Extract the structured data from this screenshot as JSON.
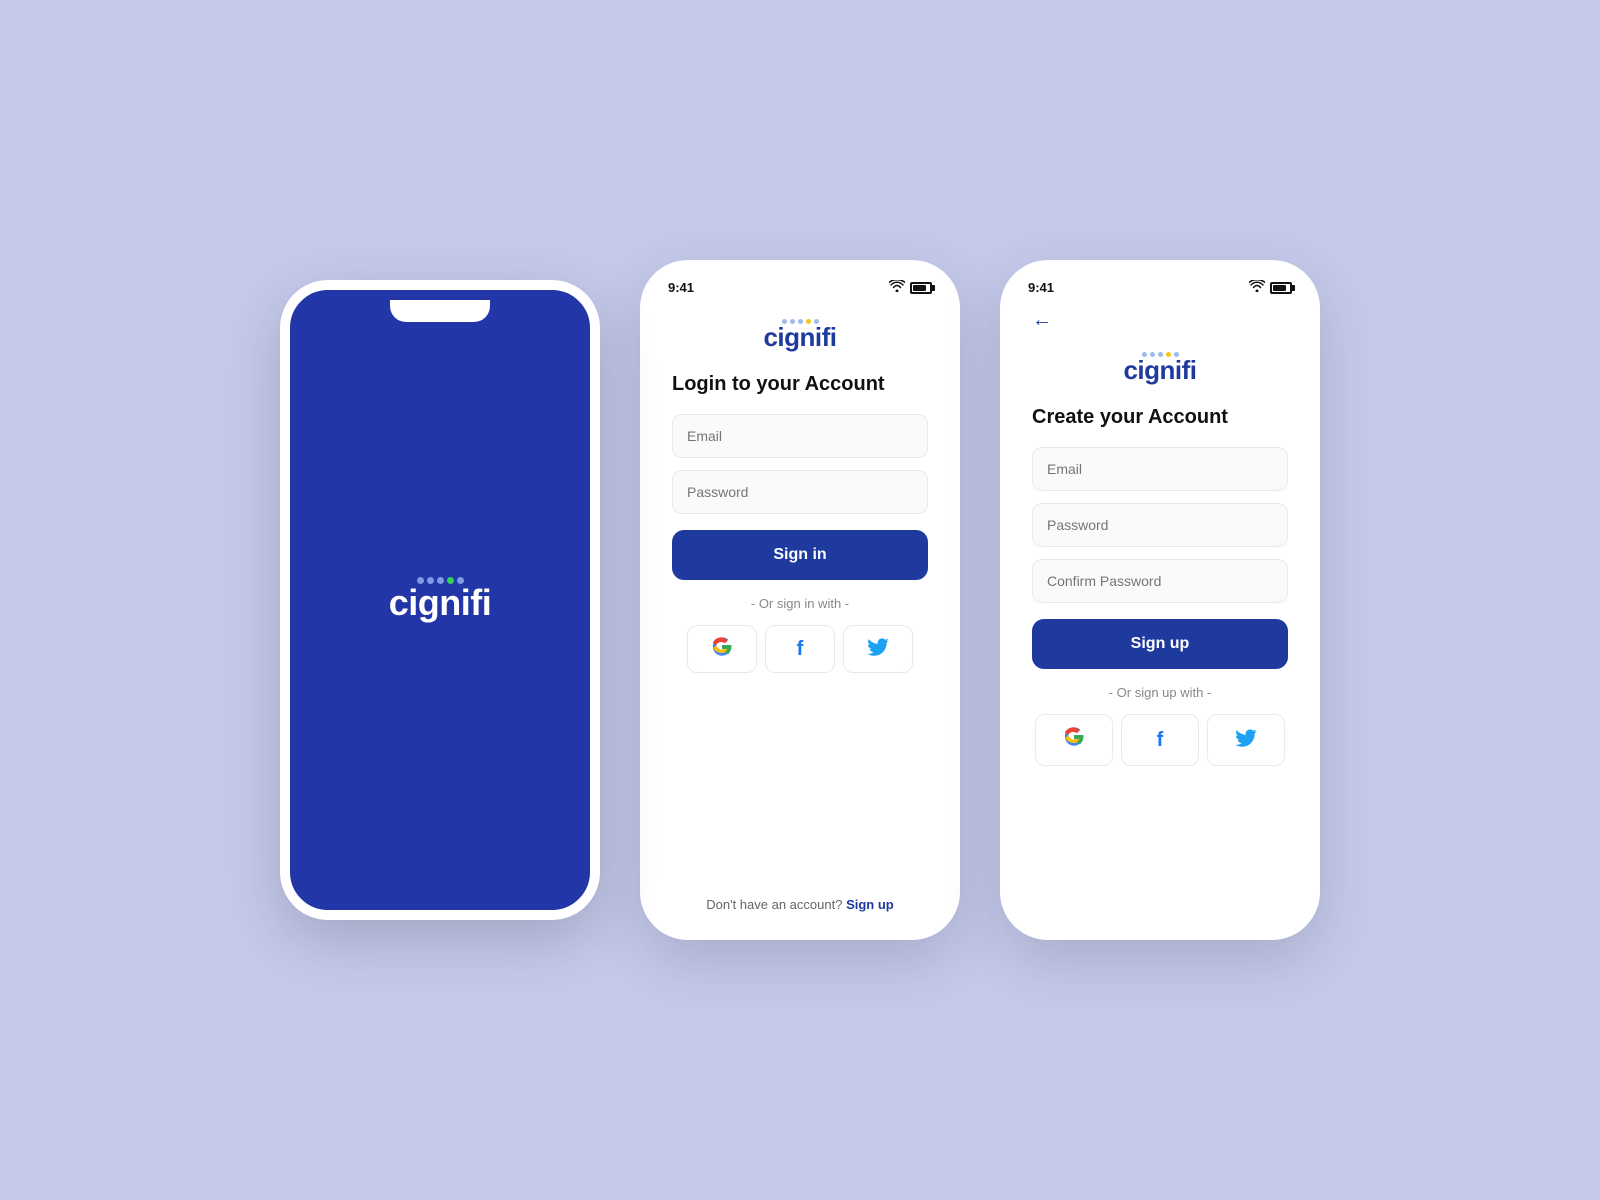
{
  "background_color": "#c5caec",
  "accent_color": "#1e3a9e",
  "splash": {
    "logo_text": "cignifi",
    "dots": [
      {
        "color": "#ffffff",
        "opacity": 0.6
      },
      {
        "color": "#ffffff",
        "opacity": 0.6
      },
      {
        "color": "#ffffff",
        "opacity": 0.6
      },
      {
        "color": "#34d058",
        "opacity": 1
      },
      {
        "color": "#ffffff",
        "opacity": 0.6
      }
    ]
  },
  "login": {
    "status_time": "9:41",
    "title": "Login to your Account",
    "email_placeholder": "Email",
    "password_placeholder": "Password",
    "sign_in_button": "Sign in",
    "or_divider": "- Or sign in with -",
    "footer_static": "Don't have an account?",
    "footer_link": "Sign up",
    "dots": [
      {
        "color": "#4a90d9"
      },
      {
        "color": "#4a90d9"
      },
      {
        "color": "#4a90d9"
      },
      {
        "color": "#f5c518"
      },
      {
        "color": "#4a90d9"
      }
    ]
  },
  "signup": {
    "status_time": "9:41",
    "title": "Create your Account",
    "email_placeholder": "Email",
    "password_placeholder": "Password",
    "confirm_password_placeholder": "Confirm Password",
    "sign_up_button": "Sign up",
    "or_divider": "- Or sign up with -",
    "dots": [
      {
        "color": "#4a90d9"
      },
      {
        "color": "#4a90d9"
      },
      {
        "color": "#4a90d9"
      },
      {
        "color": "#f5c518"
      },
      {
        "color": "#4a90d9"
      }
    ]
  }
}
